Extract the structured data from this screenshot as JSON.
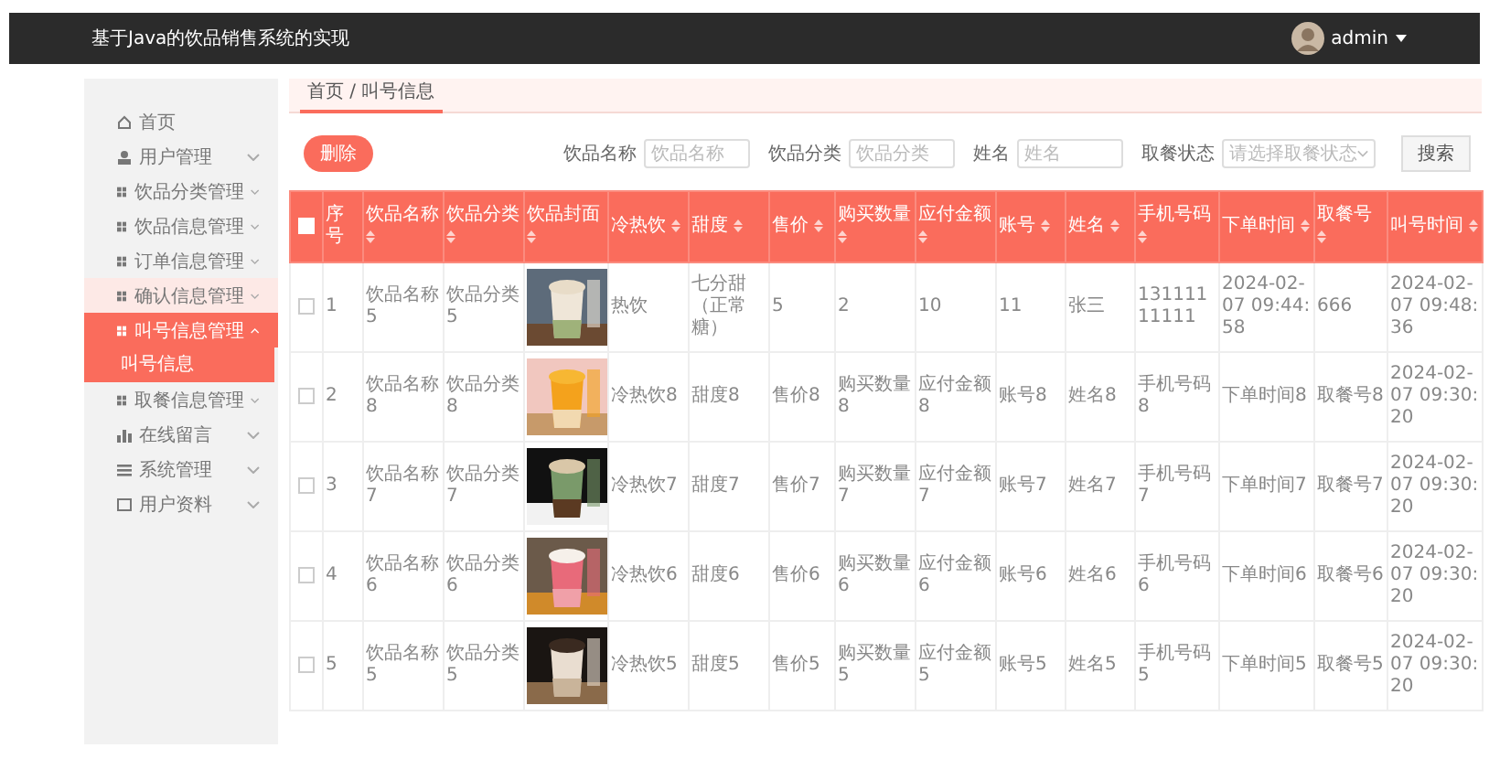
{
  "header": {
    "title": "基于Java的饮品销售系统的实现",
    "user": "admin"
  },
  "sidebar": {
    "items": [
      {
        "label": "首页",
        "expandable": false,
        "expanded": false,
        "highlighted": false
      },
      {
        "label": "用户管理",
        "expandable": true,
        "expanded": false,
        "highlighted": false
      },
      {
        "label": "饮品分类管理",
        "expandable": true,
        "expanded": false,
        "highlighted": false
      },
      {
        "label": "饮品信息管理",
        "expandable": true,
        "expanded": false,
        "highlighted": false
      },
      {
        "label": "订单信息管理",
        "expandable": true,
        "expanded": false,
        "highlighted": false
      },
      {
        "label": "确认信息管理",
        "expandable": true,
        "expanded": false,
        "highlighted": true
      },
      {
        "label": "叫号信息管理",
        "expandable": true,
        "expanded": true,
        "highlighted": false,
        "children": [
          {
            "label": "叫号信息",
            "selected": true
          }
        ]
      },
      {
        "label": "取餐信息管理",
        "expandable": true,
        "expanded": false,
        "highlighted": false
      },
      {
        "label": "在线留言",
        "expandable": true,
        "expanded": false,
        "highlighted": false
      },
      {
        "label": "系统管理",
        "expandable": true,
        "expanded": false,
        "highlighted": false
      },
      {
        "label": "用户资料",
        "expandable": true,
        "expanded": false,
        "highlighted": false
      }
    ]
  },
  "breadcrumb": "首页 / 叫号信息",
  "toolbar": {
    "delete_button": "删除",
    "filters": [
      {
        "label": "饮品名称",
        "placeholder": "饮品名称",
        "kind": "input"
      },
      {
        "label": "饮品分类",
        "placeholder": "饮品分类",
        "kind": "input"
      },
      {
        "label": "姓名",
        "placeholder": "姓名",
        "kind": "input"
      },
      {
        "label": "取餐状态",
        "placeholder": "请选择取餐状态",
        "kind": "select"
      }
    ],
    "search_button": "搜索"
  },
  "table": {
    "select_all": false,
    "columns": [
      {
        "label": "序号",
        "sortable": false
      },
      {
        "label": "饮品名称",
        "sortable": true
      },
      {
        "label": "饮品分类",
        "sortable": true
      },
      {
        "label": "饮品封面",
        "sortable": true
      },
      {
        "label": "冷热饮",
        "sortable": true
      },
      {
        "label": "甜度",
        "sortable": true
      },
      {
        "label": "售价",
        "sortable": true
      },
      {
        "label": "购买数量",
        "sortable": true
      },
      {
        "label": "应付金额",
        "sortable": true
      },
      {
        "label": "账号",
        "sortable": true
      },
      {
        "label": "姓名",
        "sortable": true
      },
      {
        "label": "手机号码",
        "sortable": true
      },
      {
        "label": "下单时间",
        "sortable": true
      },
      {
        "label": "取餐号",
        "sortable": true
      },
      {
        "label": "叫号时间",
        "sortable": true
      }
    ],
    "rows": [
      {
        "checked": false,
        "cells": [
          "1",
          "饮品名称5",
          "饮品分类5",
          {
            "kind": "picture"
          },
          "热饮",
          "七分甜（正常糖）",
          "5",
          "2",
          "10",
          "11",
          "张三",
          "13111111111",
          "2024-02-07 09:44:58",
          "666",
          "2024-02-07 09:48:36"
        ]
      },
      {
        "checked": false,
        "cells": [
          "2",
          "饮品名称8",
          "饮品分类8",
          {
            "kind": "picture"
          },
          "冷热饮8",
          "甜度8",
          "售价8",
          "购买数量8",
          "应付金额8",
          "账号8",
          "姓名8",
          "手机号码8",
          "下单时间8",
          "取餐号8",
          "2024-02-07 09:30:20"
        ]
      },
      {
        "checked": false,
        "cells": [
          "3",
          "饮品名称7",
          "饮品分类7",
          {
            "kind": "picture"
          },
          "冷热饮7",
          "甜度7",
          "售价7",
          "购买数量7",
          "应付金额7",
          "账号7",
          "姓名7",
          "手机号码7",
          "下单时间7",
          "取餐号7",
          "2024-02-07 09:30:20"
        ]
      },
      {
        "checked": false,
        "cells": [
          "4",
          "饮品名称6",
          "饮品分类6",
          {
            "kind": "picture"
          },
          "冷热饮6",
          "甜度6",
          "售价6",
          "购买数量6",
          "应付金额6",
          "账号6",
          "姓名6",
          "手机号码6",
          "下单时间6",
          "取餐号6",
          "2024-02-07 09:30:20"
        ]
      },
      {
        "checked": false,
        "cells": [
          "5",
          "饮品名称5",
          "饮品分类5",
          {
            "kind": "picture"
          },
          "冷热饮5",
          "甜度5",
          "售价5",
          "购买数量5",
          "应付金额5",
          "账号5",
          "姓名5",
          "手机号码5",
          "下单时间5",
          "取餐号5",
          "2024-02-07 09:30:20"
        ]
      }
    ]
  }
}
